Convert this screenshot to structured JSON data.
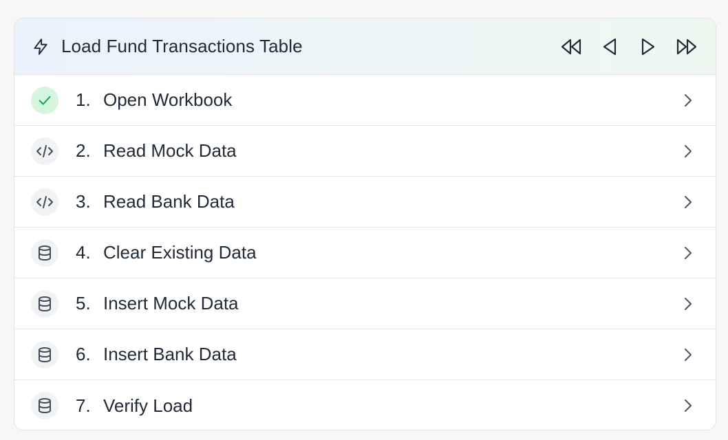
{
  "header": {
    "title": "Load Fund Transactions Table",
    "icon": "lightning-icon",
    "controls": [
      "rewind-icon",
      "step-back-icon",
      "step-forward-icon",
      "fast-forward-icon"
    ]
  },
  "steps": [
    {
      "num": "1.",
      "label": "Open Workbook",
      "icon": "check-icon",
      "status": "done"
    },
    {
      "num": "2.",
      "label": "Read Mock Data",
      "icon": "code-icon",
      "status": "pending"
    },
    {
      "num": "3.",
      "label": "Read Bank Data",
      "icon": "code-icon",
      "status": "pending"
    },
    {
      "num": "4.",
      "label": "Clear Existing Data",
      "icon": "database-icon",
      "status": "pending"
    },
    {
      "num": "5.",
      "label": "Insert Mock Data",
      "icon": "database-icon",
      "status": "pending"
    },
    {
      "num": "6.",
      "label": "Insert Bank Data",
      "icon": "database-icon",
      "status": "pending"
    },
    {
      "num": "7.",
      "label": "Verify Load",
      "icon": "database-icon",
      "status": "pending"
    }
  ],
  "colors": {
    "success": "#16a34a",
    "success_bg": "#d6f5de",
    "icon": "#3f4a5a"
  }
}
